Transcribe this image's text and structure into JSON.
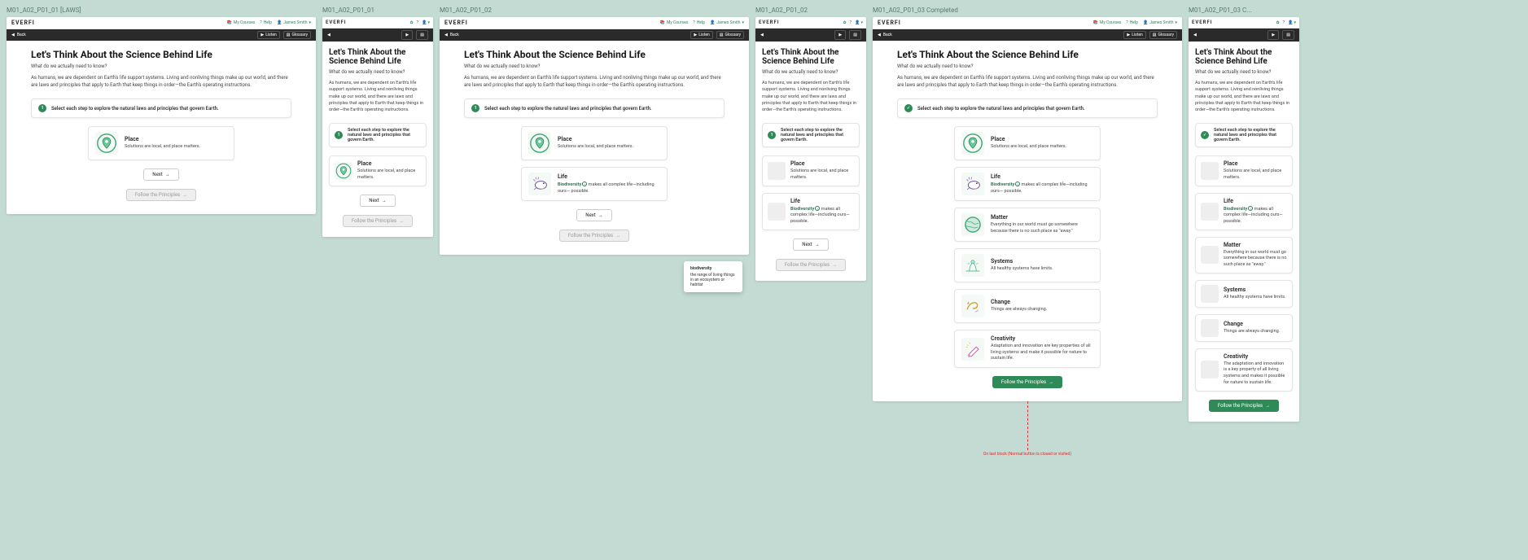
{
  "logo": "EVERFI",
  "header": {
    "courses": "My Courses",
    "help": "Help",
    "user": "James Smith"
  },
  "nav": {
    "back": "Back",
    "play": "▶",
    "listen": "Listen",
    "glossary": "Glossary"
  },
  "page": {
    "title": "Let's Think About the Science Behind Life",
    "subtitle": "What do we actually need to know?",
    "intro": "As humans, we are dependent on Earth's life support systems. Living and nonliving things make up our world, and there are laws and principles that apply to Earth that keep things in order—the Earth's operating instructions.",
    "instruction": "Select each step to explore the natural laws and principles that govern Earth."
  },
  "cards": {
    "place": {
      "title": "Place",
      "desc": "Solutions are local, and place matters."
    },
    "life": {
      "title": "Life",
      "kw": "Biodiversity",
      "rest": " makes all complex life—including ours— possible."
    },
    "matter": {
      "title": "Matter",
      "desc": "Everything in our world must go somewhere because there is no such place as \"away.\""
    },
    "systems": {
      "title": "Systems",
      "desc": "All healthy systems have limits."
    },
    "change": {
      "title": "Change",
      "desc": "Things are always changing."
    },
    "creativity": {
      "title": "Creativity",
      "desc": "Adaptation and innovation are key properties of all living systems and make it possible for nature to sustain life.",
      "desc_narrow": "The adaptation and innovation is a key property of all living systems and makes it possible for nature to sustain life."
    }
  },
  "buttons": {
    "next": "Next",
    "follow": "Follow the Principles"
  },
  "tooltip": {
    "title": "biodiversity",
    "body": "the range of living things in an ecosystem or habitat"
  },
  "labels": {
    "col0": "M01_A02_P01_01 [LAWS]",
    "col1": "M01_A02_P01_01",
    "col2": "M01_A02_P01_02",
    "col3": "M01_A02_P01_02",
    "col4": "M01_A02_P01_03 Completed",
    "col5": "M01_A02_P01_03 C..."
  },
  "rednote": "On last block (Normal button is closed or visited)"
}
